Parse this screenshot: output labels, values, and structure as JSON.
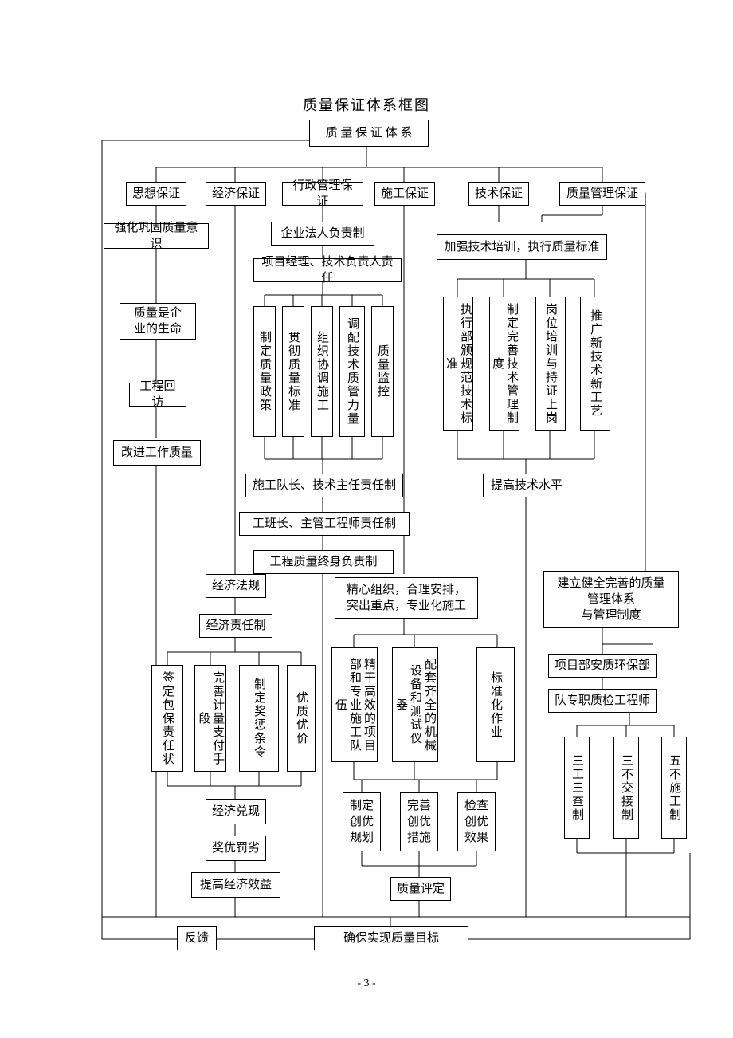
{
  "title": "质量保证体系框图",
  "root": "质 量 保 证 体 系",
  "level1": {
    "ideology": "思想保证",
    "economic": "经济保证",
    "admin": "行政管理保证",
    "construction": "施工保证",
    "technical": "技术保证",
    "quality_mgmt": "质量管理保证"
  },
  "ideology": {
    "strengthen": "强化巩固质量意识",
    "life": "质量是企\n业的生命",
    "revisit": "工程回访",
    "improve": "改进工作质量"
  },
  "admin": {
    "corp": "企业法人负责制",
    "proj": "项目经理、技术负责人责任",
    "cols": [
      "制定质量政策",
      "贯彻质量标准",
      "组织协调施工",
      "调配技术质管力量",
      "质量监控"
    ],
    "team_lead": "施工队长、技术主任责任制",
    "foreman": "工班长、主管工程师责任制",
    "lifetime": "工程质量终身负责制"
  },
  "technical": {
    "training": "加强技术培训，执行质量标准",
    "cols": [
      "执行部颁规范技术标准",
      "制定完善技术管理制度",
      "岗位培训与持证上岗",
      "推广新技术新工艺"
    ],
    "improve_level": "提高技术水平"
  },
  "economic": {
    "law": "经济法规",
    "resp": "经济责任制",
    "cols": [
      "签定包保责任状",
      "完善计量支付手段",
      "制定奖惩条令",
      "优质优价"
    ],
    "cash": "经济兑现",
    "reward": "奖优罚劣",
    "benefit": "提高经济效益"
  },
  "construction": {
    "organize": "精心组织，合理安排，\n突出重点，专业化施工",
    "cols": [
      "精干高效的项目部和专业施工队伍",
      "配套齐全的机械设备和测试仪　器",
      "标准化作业"
    ],
    "sub": [
      "制定\n创优\n规划",
      "完善\n创优\n措施",
      "检查\n创优\n效果"
    ],
    "assess": "质量评定"
  },
  "quality_mgmt": {
    "establish": "建立健全完善的质量\n管理体系\n与管理制度",
    "safety_dept": "项目部安质环保部",
    "quality_eng": "队专职质检工程师",
    "cols": [
      "三工三查制",
      "三不交接制",
      "五不施工制"
    ]
  },
  "bottom": {
    "feedback": "反馈",
    "goal": "确保实现质量目标"
  },
  "footer": "- 3 -"
}
